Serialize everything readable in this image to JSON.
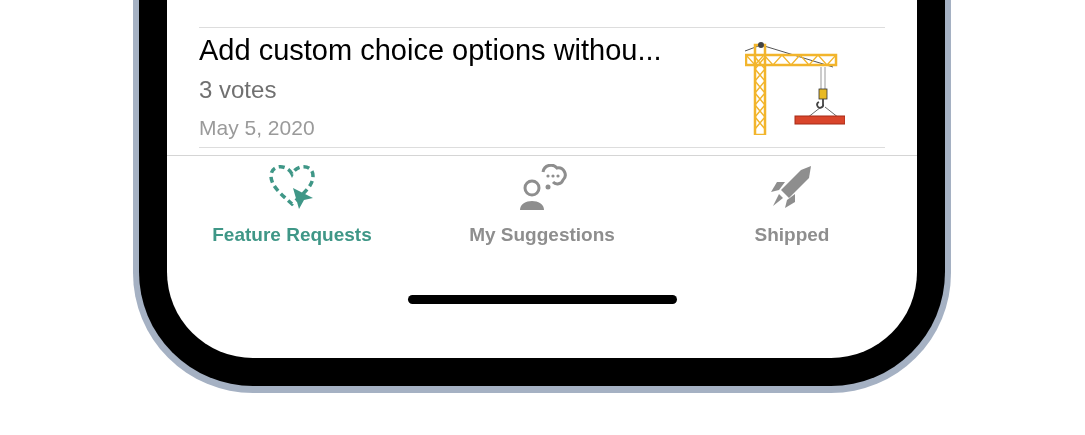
{
  "items": [
    {
      "title": "Add custom choice options withou...",
      "votes": "3 votes",
      "date": "May 5, 2020"
    }
  ],
  "tabs": [
    {
      "label": "Feature Requests",
      "selected": true
    },
    {
      "label": "My Suggestions",
      "selected": false
    },
    {
      "label": "Shipped",
      "selected": false
    }
  ]
}
